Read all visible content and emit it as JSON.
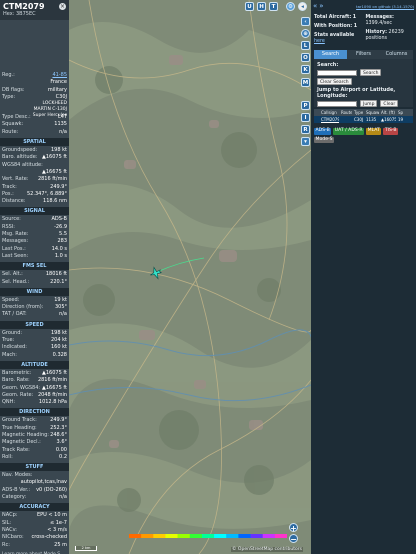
{
  "left_panel": {
    "callsign": "CTM2079",
    "hex": "Hex: 3B75EC",
    "rows_top": [
      {
        "k": "Reg.:",
        "v": "41-85",
        "link": true
      },
      {
        "k": "",
        "v": "France"
      },
      {
        "k": "DB flags:",
        "v": "military"
      },
      {
        "k": "Type:",
        "v": "C30J"
      }
    ],
    "type_desc": "LOCKHEED MARTIN C-130J Super Hercules",
    "rows_mid": [
      {
        "k": "Type Desc.:",
        "v": "L4T"
      },
      {
        "k": "Squawk:",
        "v": "1135"
      },
      {
        "k": "Route:",
        "v": "n/a"
      }
    ],
    "spatial_title": "SPATIAL",
    "spatial": [
      {
        "k": "Groundspeed:",
        "v": "198 kt"
      },
      {
        "k": "Baro. altitude:",
        "v": "▲16075 ft"
      },
      {
        "k": "WGS84 altitude:",
        "v": ""
      },
      {
        "k": "",
        "v": "▲16675 ft"
      },
      {
        "k": "Vert. Rate:",
        "v": "2816 ft/min"
      },
      {
        "k": "Track:",
        "v": "249.9°"
      },
      {
        "k": "Pos.:",
        "v": "52.347°, 6.889°"
      },
      {
        "k": "Distance:",
        "v": "118.6 nm"
      }
    ],
    "signal_title": "SIGNAL",
    "signal": [
      {
        "k": "Source:",
        "v": "ADS-B"
      },
      {
        "k": "RSSI:",
        "v": "-26.9"
      },
      {
        "k": "Msg. Rate:",
        "v": "5.5"
      },
      {
        "k": "Messages:",
        "v": "283"
      },
      {
        "k": "Last Pos.:",
        "v": "14.0 s"
      },
      {
        "k": "Last Seen:",
        "v": "1.0 s"
      }
    ],
    "fms_title": "FMS SEL",
    "fms": [
      {
        "k": "Sel. Alt.:",
        "v": "18016 ft"
      },
      {
        "k": "Sel. Head.:",
        "v": "220.1°"
      }
    ],
    "wind_title": "WIND",
    "wind": [
      {
        "k": "Speed:",
        "v": "19 kt"
      },
      {
        "k": "Direction (from):",
        "v": "305°"
      },
      {
        "k": "TAT / OAT:",
        "v": "n/a"
      }
    ],
    "speed_title": "SPEED",
    "speed": [
      {
        "k": "Ground:",
        "v": "198 kt"
      },
      {
        "k": "True:",
        "v": "204 kt"
      },
      {
        "k": "Indicated:",
        "v": "160 kt"
      },
      {
        "k": "Mach:",
        "v": "0.328"
      }
    ],
    "altitude_title": "ALTITUDE",
    "altitude": [
      {
        "k": "Barometric:",
        "v": "▲16075 ft"
      },
      {
        "k": "Baro. Rate:",
        "v": "2816 ft/min"
      },
      {
        "k": "Geom. WGS84:",
        "v": "▲16675 ft"
      },
      {
        "k": "Geom. Rate:",
        "v": "2048 ft/min"
      },
      {
        "k": "QNH:",
        "v": "1012.8 hPa"
      }
    ],
    "direction_title": "DIRECTION",
    "direction": [
      {
        "k": "Ground Track:",
        "v": "249.9°"
      },
      {
        "k": "True Heading:",
        "v": "252.3°"
      },
      {
        "k": "Magnetic Heading:",
        "v": "248.6°"
      },
      {
        "k": "Magnetic Decl.:",
        "v": "3.6°"
      },
      {
        "k": "Track Rate:",
        "v": "0.00"
      },
      {
        "k": "Roll:",
        "v": "0.2"
      }
    ],
    "stuff_title": "STUFF",
    "stuff": [
      {
        "k": "Nav. Modes:",
        "v": ""
      },
      {
        "k": "",
        "v": "autopilot,tcas,lnav"
      },
      {
        "k": "ADS-B Ver.:",
        "v": "v0 (DO-260)"
      },
      {
        "k": "Category:",
        "v": "n/a"
      }
    ],
    "accuracy_title": "ACCURACY",
    "accuracy": [
      {
        "k": "NACp:",
        "v": "EPU < 10 m"
      },
      {
        "k": "SIL:",
        "v": "≤ 1e-7"
      },
      {
        "k": "NACv:",
        "v": "< 3 m/s"
      },
      {
        "k": "NICbaro:",
        "v": "cross-checked"
      },
      {
        "k": "Rc:",
        "v": "25 m"
      }
    ],
    "footer_note": "Learn more about Mode S data type by hovering over"
  },
  "map": {
    "buttons_top": [
      "U",
      "H",
      "T"
    ],
    "buttons_side": [
      "L",
      "O",
      "K",
      "M",
      "P",
      "I",
      "R"
    ],
    "scale_text": "2 km",
    "attribution": "© OpenStreetMap contributors",
    "zoom_in": "+",
    "zoom_out": "−",
    "altitude_scale_colors": [
      "#ff6a00",
      "#ff9900",
      "#ffcc00",
      "#e6ff00",
      "#99ff00",
      "#33ff33",
      "#00ff99",
      "#00ffff",
      "#00bbff",
      "#0066ff",
      "#6633ff",
      "#cc33ff",
      "#ff33cc"
    ]
  },
  "right_panel": {
    "version": "tar1090 on github (3.14.1570)",
    "stats": {
      "total_label": "Total Aircraft:",
      "total_value": "1",
      "with_pos_label": "With Position:",
      "with_pos_value": "1",
      "stats_label": "Stats available",
      "stats_link": "here",
      "messages_label": "Messages:",
      "messages_value": "1399.4/sec",
      "history_label": "History:",
      "history_value": "26239 positions"
    },
    "tabs": [
      "Search",
      "Filters",
      "Columns"
    ],
    "search_label": "Search:",
    "search_button": "Search",
    "clear_search": "Clear Search",
    "jump_label": "Jump to Airport or Latitude, Longitude:",
    "jump_button": "Jump",
    "clear_button": "Clear",
    "table_headers": [
      "",
      "Callsign",
      "Route",
      "Type",
      "Squawk",
      "Alt. (ft)",
      "Spd"
    ],
    "table_rows": [
      [
        "",
        "CTM2079",
        "",
        "C30J",
        "1135",
        "▲16075",
        "19"
      ]
    ],
    "legend": [
      {
        "label": "ADS-B",
        "color": "#1f6fb8"
      },
      {
        "label": "UAT / ADS-R",
        "color": "#2a8c3c"
      },
      {
        "label": "MLAT",
        "color": "#b58a16"
      },
      {
        "label": "TIS-B",
        "color": "#b84545"
      },
      {
        "label": "Mode-S",
        "color": "#6b6b6b"
      }
    ]
  }
}
